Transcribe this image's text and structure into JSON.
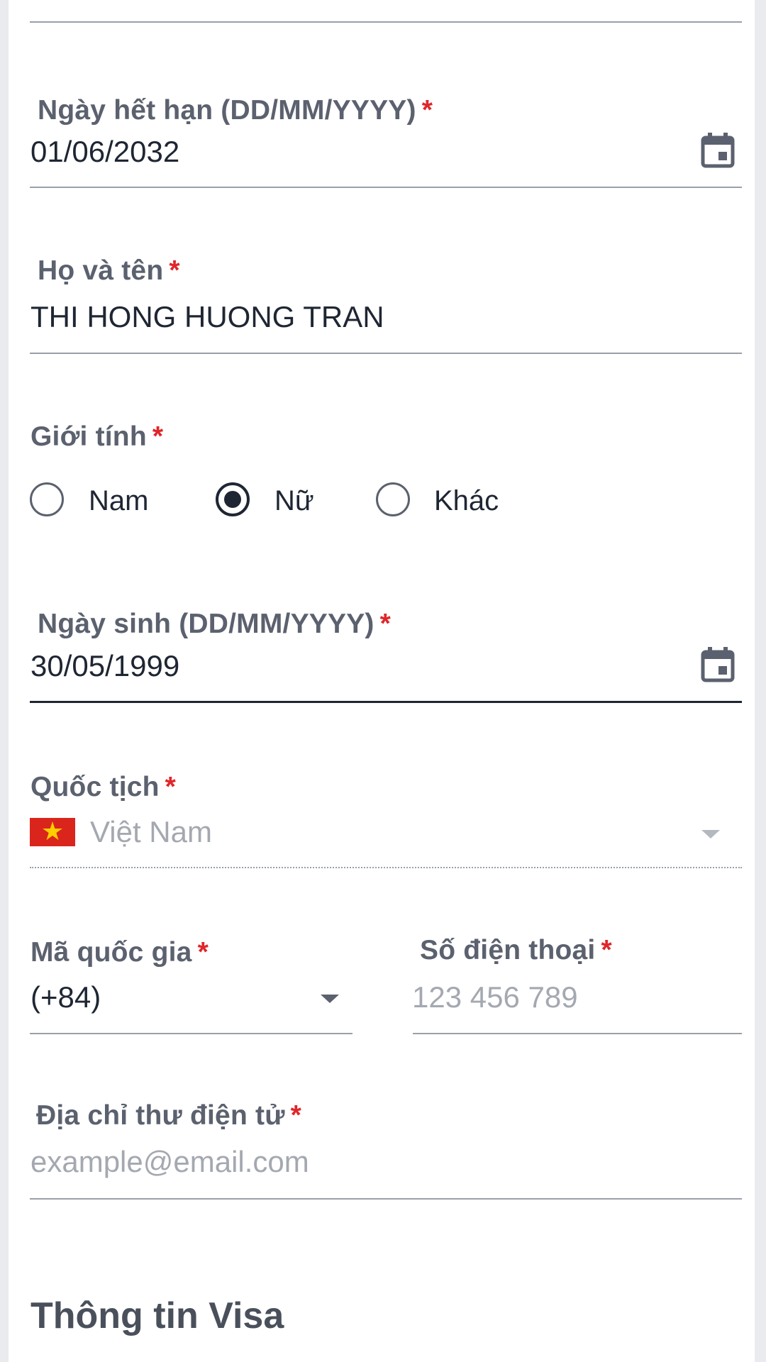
{
  "form": {
    "required_marker": "*",
    "expiry_date": {
      "label": "Ngày hết hạn (DD/MM/YYYY)",
      "value": "01/06/2032",
      "icon": "calendar-icon"
    },
    "full_name": {
      "label": "Họ và tên",
      "value": "THI HONG HUONG TRAN"
    },
    "gender": {
      "label": "Giới tính",
      "options": [
        "Nam",
        "Nữ",
        "Khác"
      ],
      "selected": "Nữ"
    },
    "birth_date": {
      "label": "Ngày sinh (DD/MM/YYYY)",
      "value": "30/05/1999",
      "icon": "calendar-icon"
    },
    "nationality": {
      "label": "Quốc tịch",
      "value": "Việt Nam",
      "flag": "vietnam-flag-icon"
    },
    "country_code": {
      "label": "Mã quốc gia",
      "value": "(+84)"
    },
    "phone": {
      "label": "Số điện thoại",
      "placeholder": "123 456 789"
    },
    "email": {
      "label": "Địa chỉ thư điện tử",
      "placeholder": "example@email.com"
    }
  },
  "section": {
    "visa_title": "Thông tin Visa"
  },
  "colors": {
    "required": "#e0262a",
    "label": "#5b616e",
    "text": "#1f2633",
    "placeholder": "#a4a8b0",
    "underline": "#9aa0a8",
    "flag_red": "#da251d",
    "flag_star": "#ffcd00"
  }
}
